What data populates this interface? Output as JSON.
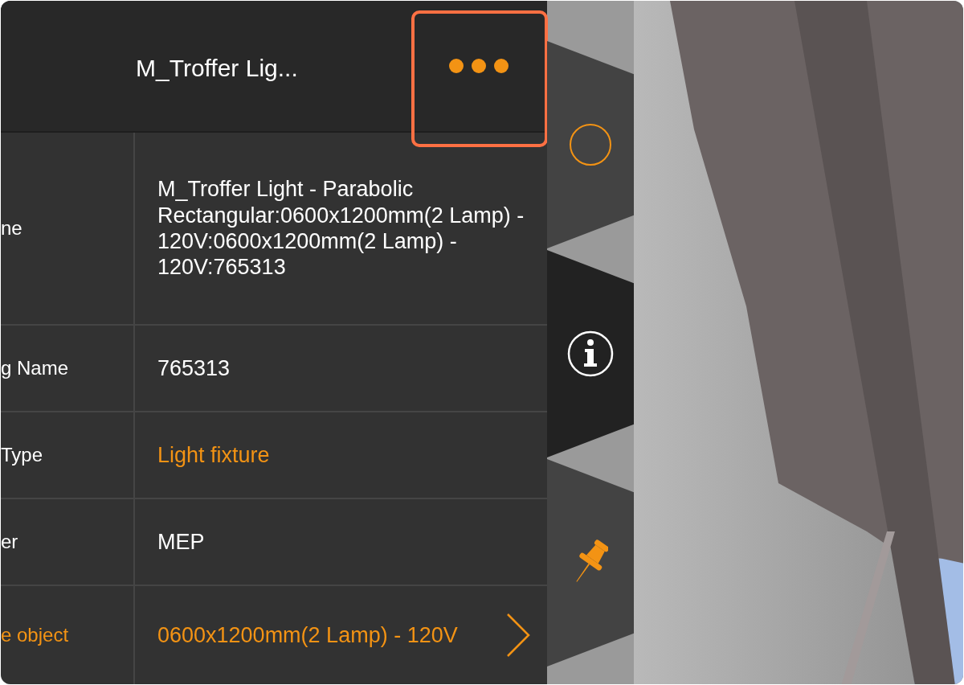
{
  "header": {
    "title": "M_Troffer Lig...",
    "more_highlighted": true
  },
  "properties": [
    {
      "label": "ne",
      "value": "M_Troffer Light - Parabolic Rectangular:0600x1200mm(2 Lamp) - 120V:0600x1200mm(2 Lamp) - 120V:765313",
      "kind": "text"
    },
    {
      "label": "g Name",
      "value": "765313",
      "kind": "text"
    },
    {
      "label": "Type",
      "value": "Light fixture",
      "kind": "link"
    },
    {
      "label": "er",
      "value": "MEP",
      "kind": "text"
    },
    {
      "label": "e object",
      "value": "0600x1200mm(2 Lamp) - 120V",
      "kind": "navigate"
    }
  ],
  "side_tabs": [
    {
      "kind": "circle",
      "selected": false
    },
    {
      "kind": "info",
      "selected": true
    },
    {
      "kind": "pin",
      "selected": false
    }
  ]
}
